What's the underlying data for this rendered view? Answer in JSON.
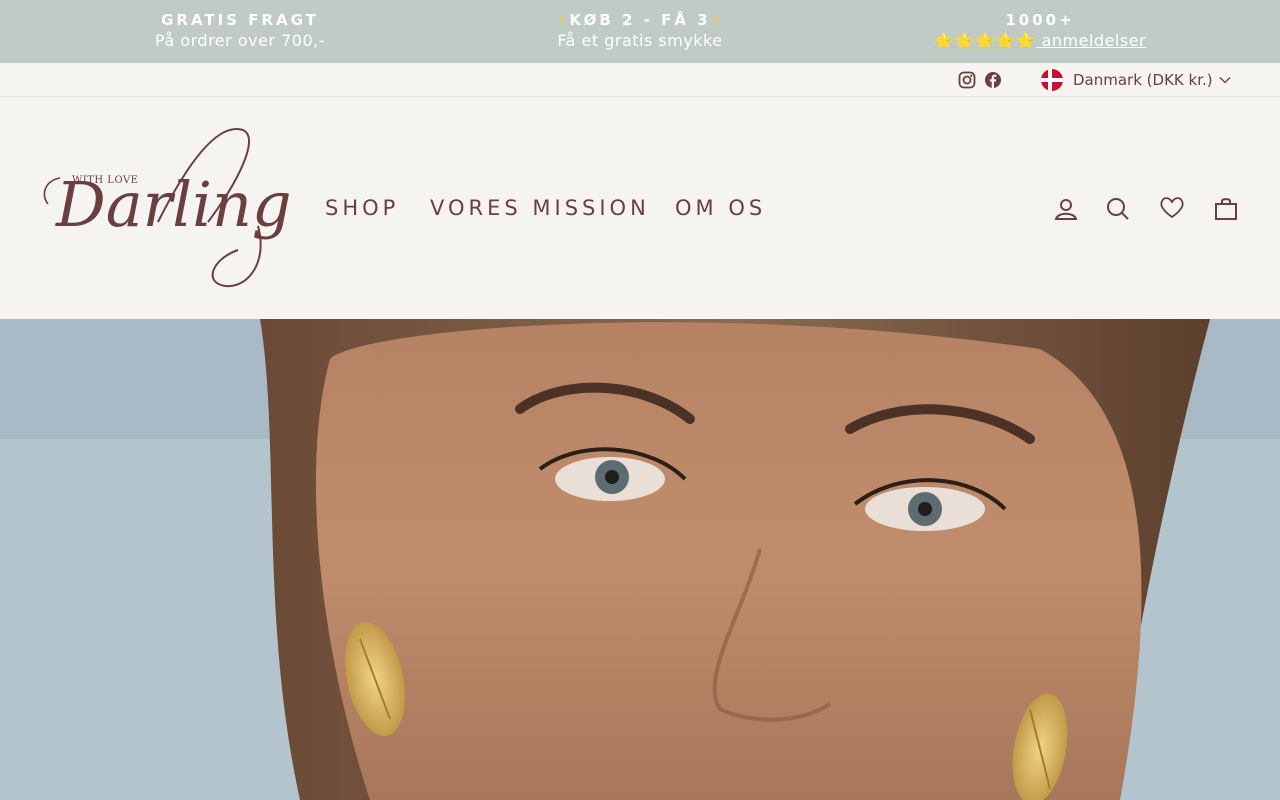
{
  "announcement": {
    "free_shipping_title": "GRATIS FRAGT",
    "free_shipping_text": "På ordrer over 700,-",
    "promo_bolt_left": "⚡",
    "promo_title": "KØB 2 - FÅ 3",
    "promo_bolt_right": "⚡",
    "promo_text": "Få et gratis smykke",
    "reviews_title": "1000+",
    "reviews_stars": "⭐⭐⭐⭐⭐",
    "reviews_link": " anmeldelser"
  },
  "utility": {
    "social": [
      "instagram-icon",
      "facebook-icon"
    ],
    "country_selector": "Danmark (DKK kr.)"
  },
  "header": {
    "logo_small_text": "WITH LOVE",
    "logo_text": "Darling",
    "nav": [
      "SHOP",
      "VORES MISSION",
      "OM OS"
    ],
    "icons": [
      "user-icon",
      "search-icon",
      "heart-icon",
      "bag-icon"
    ]
  },
  "colors": {
    "announcement_bg": "#bfcbc4",
    "brand_text": "#6b3f3f",
    "page_bg": "#f5f4f0"
  }
}
